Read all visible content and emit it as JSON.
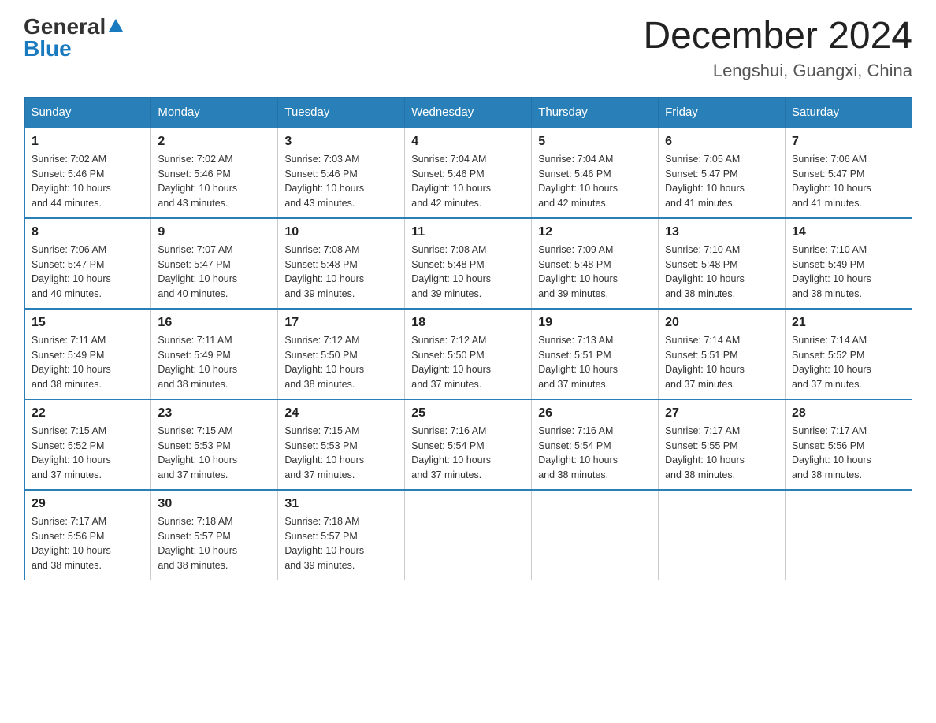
{
  "header": {
    "logo": {
      "general": "General",
      "blue": "Blue",
      "arrow": "▶"
    },
    "title": "December 2024",
    "subtitle": "Lengshui, Guangxi, China"
  },
  "days_of_week": [
    "Sunday",
    "Monday",
    "Tuesday",
    "Wednesday",
    "Thursday",
    "Friday",
    "Saturday"
  ],
  "weeks": [
    [
      {
        "day": "1",
        "sunrise": "7:02 AM",
        "sunset": "5:46 PM",
        "daylight": "10 hours and 44 minutes."
      },
      {
        "day": "2",
        "sunrise": "7:02 AM",
        "sunset": "5:46 PM",
        "daylight": "10 hours and 43 minutes."
      },
      {
        "day": "3",
        "sunrise": "7:03 AM",
        "sunset": "5:46 PM",
        "daylight": "10 hours and 43 minutes."
      },
      {
        "day": "4",
        "sunrise": "7:04 AM",
        "sunset": "5:46 PM",
        "daylight": "10 hours and 42 minutes."
      },
      {
        "day": "5",
        "sunrise": "7:04 AM",
        "sunset": "5:46 PM",
        "daylight": "10 hours and 42 minutes."
      },
      {
        "day": "6",
        "sunrise": "7:05 AM",
        "sunset": "5:47 PM",
        "daylight": "10 hours and 41 minutes."
      },
      {
        "day": "7",
        "sunrise": "7:06 AM",
        "sunset": "5:47 PM",
        "daylight": "10 hours and 41 minutes."
      }
    ],
    [
      {
        "day": "8",
        "sunrise": "7:06 AM",
        "sunset": "5:47 PM",
        "daylight": "10 hours and 40 minutes."
      },
      {
        "day": "9",
        "sunrise": "7:07 AM",
        "sunset": "5:47 PM",
        "daylight": "10 hours and 40 minutes."
      },
      {
        "day": "10",
        "sunrise": "7:08 AM",
        "sunset": "5:48 PM",
        "daylight": "10 hours and 39 minutes."
      },
      {
        "day": "11",
        "sunrise": "7:08 AM",
        "sunset": "5:48 PM",
        "daylight": "10 hours and 39 minutes."
      },
      {
        "day": "12",
        "sunrise": "7:09 AM",
        "sunset": "5:48 PM",
        "daylight": "10 hours and 39 minutes."
      },
      {
        "day": "13",
        "sunrise": "7:10 AM",
        "sunset": "5:48 PM",
        "daylight": "10 hours and 38 minutes."
      },
      {
        "day": "14",
        "sunrise": "7:10 AM",
        "sunset": "5:49 PM",
        "daylight": "10 hours and 38 minutes."
      }
    ],
    [
      {
        "day": "15",
        "sunrise": "7:11 AM",
        "sunset": "5:49 PM",
        "daylight": "10 hours and 38 minutes."
      },
      {
        "day": "16",
        "sunrise": "7:11 AM",
        "sunset": "5:49 PM",
        "daylight": "10 hours and 38 minutes."
      },
      {
        "day": "17",
        "sunrise": "7:12 AM",
        "sunset": "5:50 PM",
        "daylight": "10 hours and 38 minutes."
      },
      {
        "day": "18",
        "sunrise": "7:12 AM",
        "sunset": "5:50 PM",
        "daylight": "10 hours and 37 minutes."
      },
      {
        "day": "19",
        "sunrise": "7:13 AM",
        "sunset": "5:51 PM",
        "daylight": "10 hours and 37 minutes."
      },
      {
        "day": "20",
        "sunrise": "7:14 AM",
        "sunset": "5:51 PM",
        "daylight": "10 hours and 37 minutes."
      },
      {
        "day": "21",
        "sunrise": "7:14 AM",
        "sunset": "5:52 PM",
        "daylight": "10 hours and 37 minutes."
      }
    ],
    [
      {
        "day": "22",
        "sunrise": "7:15 AM",
        "sunset": "5:52 PM",
        "daylight": "10 hours and 37 minutes."
      },
      {
        "day": "23",
        "sunrise": "7:15 AM",
        "sunset": "5:53 PM",
        "daylight": "10 hours and 37 minutes."
      },
      {
        "day": "24",
        "sunrise": "7:15 AM",
        "sunset": "5:53 PM",
        "daylight": "10 hours and 37 minutes."
      },
      {
        "day": "25",
        "sunrise": "7:16 AM",
        "sunset": "5:54 PM",
        "daylight": "10 hours and 37 minutes."
      },
      {
        "day": "26",
        "sunrise": "7:16 AM",
        "sunset": "5:54 PM",
        "daylight": "10 hours and 38 minutes."
      },
      {
        "day": "27",
        "sunrise": "7:17 AM",
        "sunset": "5:55 PM",
        "daylight": "10 hours and 38 minutes."
      },
      {
        "day": "28",
        "sunrise": "7:17 AM",
        "sunset": "5:56 PM",
        "daylight": "10 hours and 38 minutes."
      }
    ],
    [
      {
        "day": "29",
        "sunrise": "7:17 AM",
        "sunset": "5:56 PM",
        "daylight": "10 hours and 38 minutes."
      },
      {
        "day": "30",
        "sunrise": "7:18 AM",
        "sunset": "5:57 PM",
        "daylight": "10 hours and 38 minutes."
      },
      {
        "day": "31",
        "sunrise": "7:18 AM",
        "sunset": "5:57 PM",
        "daylight": "10 hours and 39 minutes."
      },
      null,
      null,
      null,
      null
    ]
  ],
  "labels": {
    "sunrise": "Sunrise: ",
    "sunset": "Sunset: ",
    "daylight": "Daylight: "
  }
}
